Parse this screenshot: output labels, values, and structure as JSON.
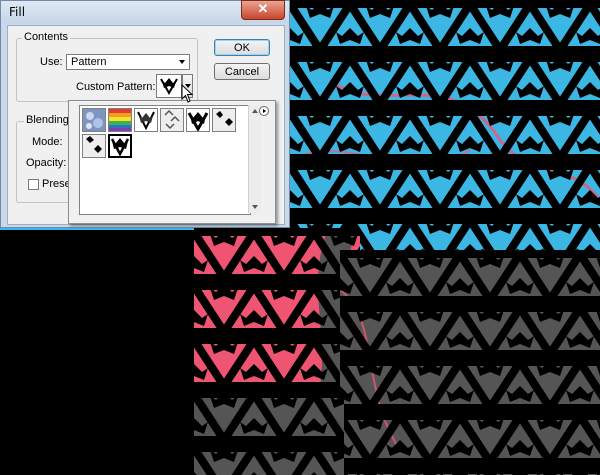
{
  "dialog": {
    "title": "Fill",
    "close_label": "✕",
    "ok_label": "OK",
    "cancel_label": "Cancel",
    "contents_group_label": "Contents",
    "use_label": "Use:",
    "use_value": "Pattern",
    "custom_pattern_label": "Custom Pattern:",
    "blending_group_label": "Blending",
    "mode_label": "Mode:",
    "opacity_label": "Opacity:",
    "preserve_label": "Preser"
  },
  "pattern_picker": {
    "thumbnails": [
      "bubbles-pattern",
      "rainbow-pattern",
      "crest-pattern",
      "crest-outline-pattern",
      "crest-bold-pattern",
      "crest-check-pattern",
      "crest-small-pattern",
      "crest-large-pattern"
    ],
    "selected_index": 7
  },
  "colors": {
    "canvas_cyan": "#3cb6e3",
    "canvas_pink": "#ef5472",
    "canvas_gray": "#555555",
    "pattern_black": "#000000",
    "dialog_frame": "#c9d9ea",
    "close_red": "#c9452c"
  }
}
